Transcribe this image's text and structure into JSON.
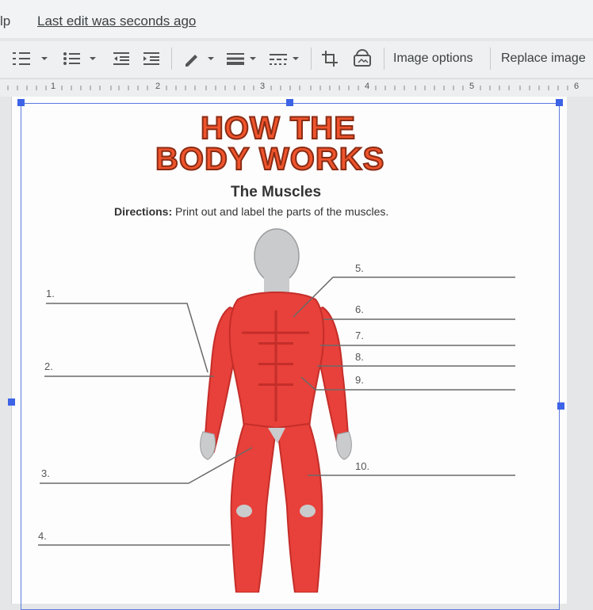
{
  "menubar": {
    "help_fragment": "lp",
    "last_edit": "Last edit was seconds ago"
  },
  "toolbar": {
    "image_options": "Image options",
    "replace_image": "Replace image",
    "icons": [
      "line-spacing-icon",
      "bulleted-list-icon",
      "numbered-list-icon",
      "decrease-indent-icon",
      "increase-indent-icon",
      "border-color-icon",
      "border-weight-icon",
      "border-dash-icon",
      "crop-icon",
      "reset-image-icon"
    ]
  },
  "ruler": {
    "numbers": [
      "1",
      "2",
      "3",
      "4",
      "5",
      "6"
    ]
  },
  "worksheet": {
    "title_line1": "HOW THE",
    "title_line2": "BODY WORKS",
    "subtitle": "The Muscles",
    "directions_label": "Directions:",
    "directions_text": " Print out and label the parts of the muscles.",
    "labels": [
      "1.",
      "2.",
      "3.",
      "4.",
      "5.",
      "6.",
      "7.",
      "8.",
      "9.",
      "10."
    ]
  },
  "colors": {
    "muscle_red": "#e8403a",
    "muscle_dark": "#c42e2a",
    "skin_gray": "#c9cbcc",
    "title_orange": "#f0542c"
  }
}
